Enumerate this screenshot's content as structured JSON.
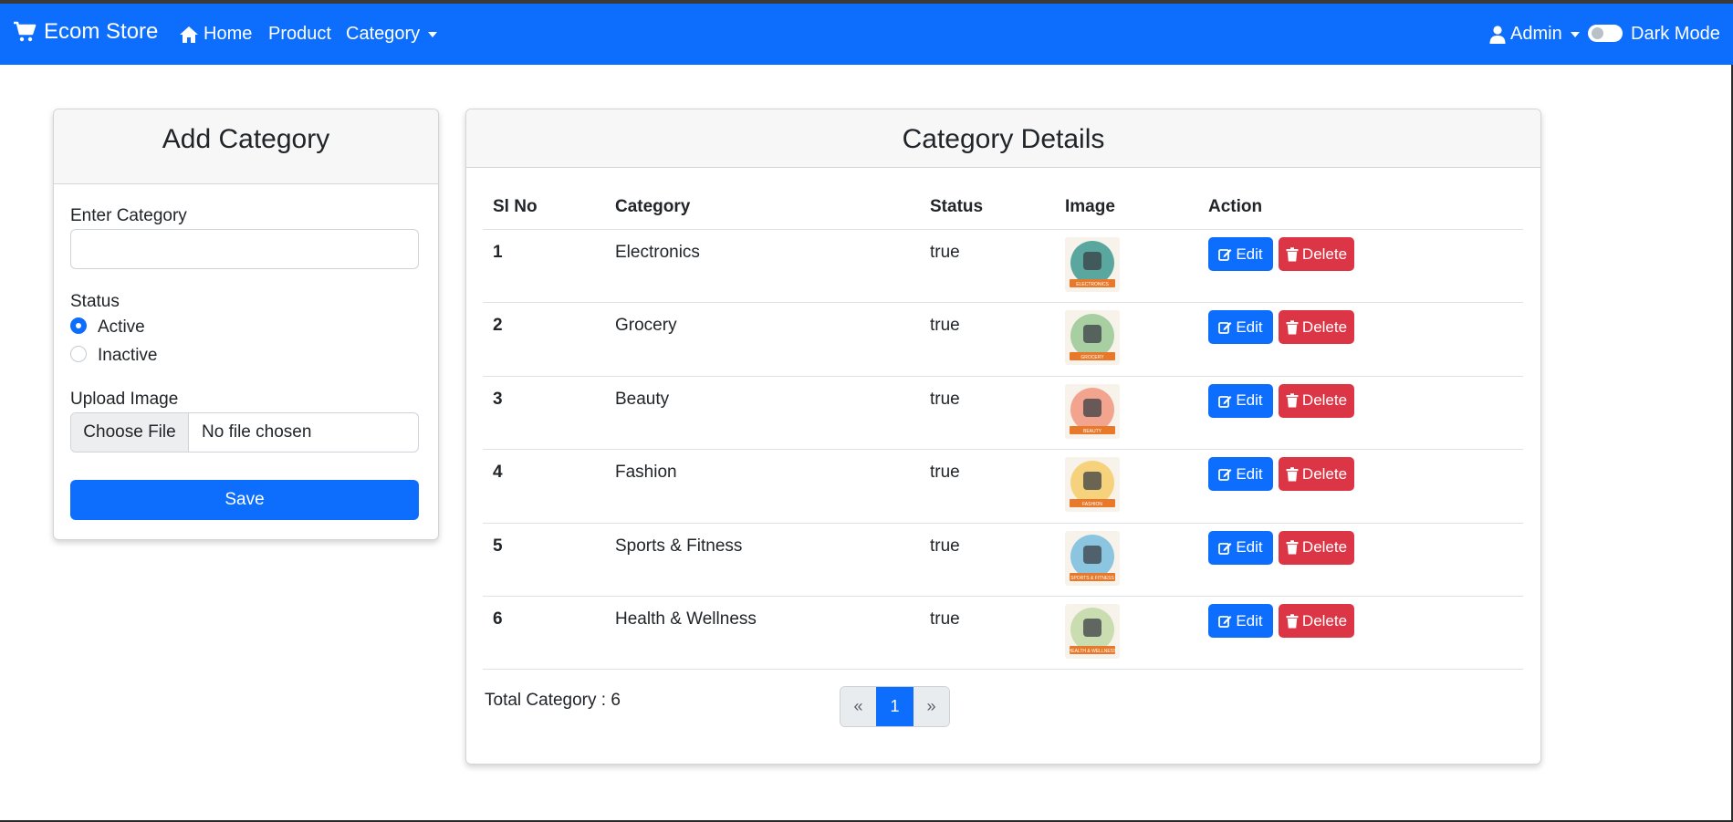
{
  "navbar": {
    "brand": "Ecom Store",
    "home": "Home",
    "product": "Product",
    "category": "Category",
    "user": "Admin",
    "dark_mode": "Dark Mode"
  },
  "add_category": {
    "title": "Add Category",
    "category_label": "Enter Category",
    "category_value": "",
    "status_label": "Status",
    "active_label": "Active",
    "inactive_label": "Inactive",
    "selected_status": "Active",
    "upload_label": "Upload Image",
    "choose_file": "Choose File",
    "no_file": "No file chosen",
    "save": "Save"
  },
  "details": {
    "title": "Category Details",
    "headers": [
      "Sl No",
      "Category",
      "Status",
      "Image",
      "Action"
    ],
    "rows": [
      {
        "sl": "1",
        "category": "Electronics",
        "status": "true",
        "image_text": "ELECTRONICS",
        "image_color": "#5aa7a0"
      },
      {
        "sl": "2",
        "category": "Grocery",
        "status": "true",
        "image_text": "GROCERY",
        "image_color": "#a7cfa1"
      },
      {
        "sl": "3",
        "category": "Beauty",
        "status": "true",
        "image_text": "BEAUTY",
        "image_color": "#f2a48f"
      },
      {
        "sl": "4",
        "category": "Fashion",
        "status": "true",
        "image_text": "FASHION",
        "image_color": "#f5d27b"
      },
      {
        "sl": "5",
        "category": "Sports & Fitness",
        "status": "true",
        "image_text": "SPORTS & FITNESS",
        "image_color": "#8cc5df"
      },
      {
        "sl": "6",
        "category": "Health & Wellness",
        "status": "true",
        "image_text": "HEALTH & WELLNESS",
        "image_color": "#c9ddb0"
      }
    ],
    "edit_label": "Edit",
    "delete_label": "Delete",
    "total": "Total Category : 6",
    "pagination": {
      "prev": "«",
      "current": "1",
      "next": "»"
    }
  },
  "colors": {
    "primary": "#0d6efd",
    "danger": "#dc3545",
    "thumb_label_bg": "#e8792b"
  }
}
